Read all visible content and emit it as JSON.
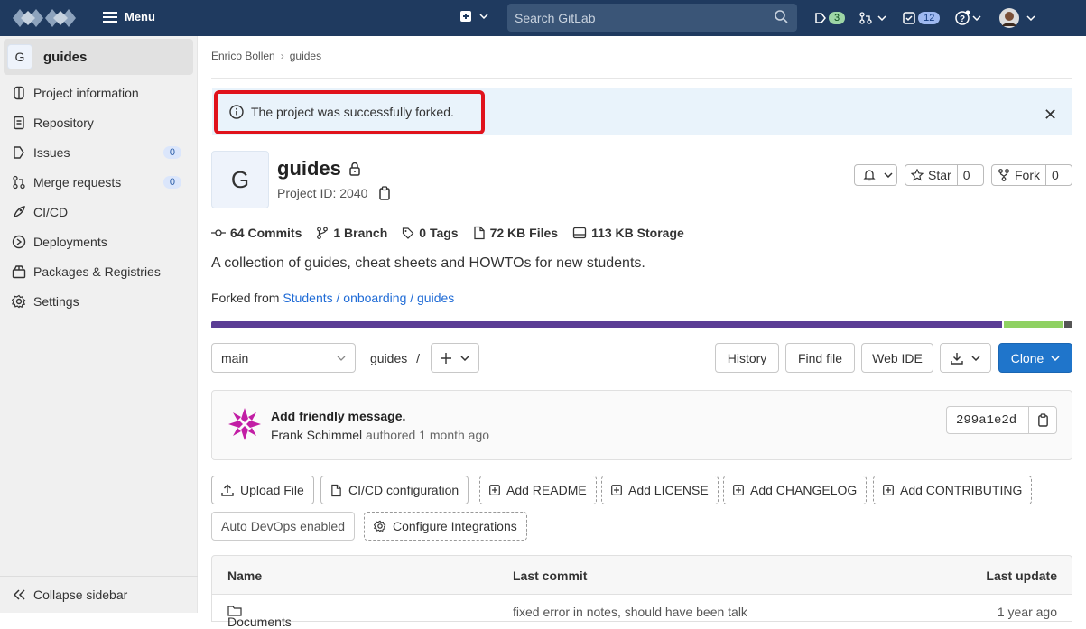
{
  "topbar": {
    "menu_label": "Menu",
    "search_placeholder": "Search GitLab",
    "issues_count": "3",
    "todos_count": "12"
  },
  "sidebar": {
    "project_initial": "G",
    "project_name": "guides",
    "items": [
      {
        "label": "Project information",
        "icon": "info-icon"
      },
      {
        "label": "Repository",
        "icon": "doc-icon"
      },
      {
        "label": "Issues",
        "icon": "issues-icon",
        "count": "0"
      },
      {
        "label": "Merge requests",
        "icon": "merge-icon",
        "count": "0"
      },
      {
        "label": "CI/CD",
        "icon": "rocket-icon"
      },
      {
        "label": "Deployments",
        "icon": "deploy-icon"
      },
      {
        "label": "Packages & Registries",
        "icon": "package-icon"
      },
      {
        "label": "Settings",
        "icon": "gear-icon"
      }
    ],
    "collapse_label": "Collapse sidebar"
  },
  "breadcrumb": {
    "owner": "Enrico Bollen",
    "project": "guides"
  },
  "alert": {
    "text": "The project was successfully forked."
  },
  "project": {
    "initial": "G",
    "title": "guides",
    "id_label": "Project ID: 2040",
    "star_label": "Star",
    "star_count": "0",
    "fork_label": "Fork",
    "fork_count": "0"
  },
  "stats": {
    "commits": "64 Commits",
    "branches": "1 Branch",
    "tags": "0 Tags",
    "files": "72 KB Files",
    "storage": "113 KB Storage"
  },
  "description": "A collection of guides, cheat sheets and HOWTOs for new students.",
  "forked_from": {
    "prefix": "Forked from",
    "link": "Students / onboarding / guides"
  },
  "language_bar": [
    {
      "share": 0.922,
      "color": "#5b3d95"
    },
    {
      "share": 0.068,
      "color": "#8fd162"
    },
    {
      "share": 0.01,
      "color": "#555555"
    }
  ],
  "repo_toolbar": {
    "branch": "main",
    "path": "guides",
    "path_sep": "/",
    "history": "History",
    "find_file": "Find file",
    "web_ide": "Web IDE",
    "clone": "Clone"
  },
  "commit": {
    "title": "Add friendly message.",
    "author": "Frank Schimmel",
    "meta": "authored 1 month ago",
    "sha": "299a1e2d"
  },
  "actions": {
    "upload": "Upload File",
    "cicd": "CI/CD configuration",
    "readme": "Add README",
    "license": "Add LICENSE",
    "changelog": "Add CHANGELOG",
    "contributing": "Add CONTRIBUTING",
    "autodevops": "Auto DevOps enabled",
    "integrations": "Configure Integrations"
  },
  "table": {
    "headers": [
      "Name",
      "Last commit",
      "Last update"
    ],
    "rows": [
      [
        "Documents",
        "fixed error in notes, should have been talk",
        "1 year ago"
      ]
    ]
  },
  "colors": {
    "topbar": "#1f3a5f",
    "primary": "#1f75cb",
    "highlight": "#e0121c"
  }
}
